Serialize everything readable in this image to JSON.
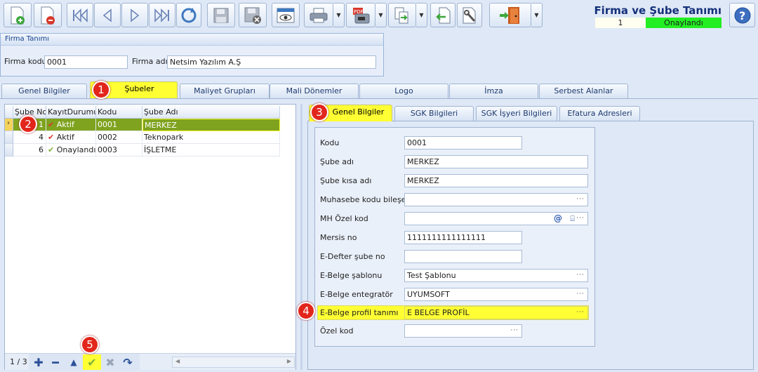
{
  "window": {
    "title": "Firma ve Şube Tanımı",
    "record_no": "1",
    "status": "Onaylandı",
    "status_color": "#22ee22"
  },
  "toolbar": {
    "icons": [
      "new-document-icon",
      "delete-document-icon",
      "first-record-icon",
      "previous-record-icon",
      "next-record-icon",
      "last-record-icon",
      "refresh-icon",
      "save-icon",
      "save-cancel-icon",
      "preview-icon",
      "print-icon",
      "pdf-export-icon",
      "export-icon",
      "back-icon",
      "settings-icon",
      "exit-icon",
      "help-icon"
    ]
  },
  "firma": {
    "group_title": "Firma Tanımı",
    "kod_label": "Firma kodu",
    "kod_value": "0001",
    "adi_label": "Firma adı",
    "adi_value": "Netsim Yazılım A.Ş"
  },
  "main_tabs": [
    {
      "label": "Genel Bilgiler"
    },
    {
      "label": "Şubeler"
    },
    {
      "label": "Maliyet Grupları"
    },
    {
      "label": "Mali Dönemler"
    },
    {
      "label": "Logo"
    },
    {
      "label": "İmza"
    },
    {
      "label": "Serbest Alanlar"
    }
  ],
  "grid": {
    "columns": [
      "Şube No",
      "KayıtDurumu",
      "Kodu",
      "Şube Adı"
    ],
    "rows": [
      {
        "no": "1",
        "durum": "Aktif",
        "kod": "0001",
        "ad": "MERKEZ"
      },
      {
        "no": "4",
        "durum": "Aktif",
        "kod": "0002",
        "ad": "Teknopark"
      },
      {
        "no": "6",
        "durum": "Onaylandı",
        "kod": "0003",
        "ad": "İŞLETME"
      }
    ],
    "pager": "1 / 3"
  },
  "sub_tabs": [
    {
      "label": "Genel Bilgiler"
    },
    {
      "label": "SGK Bilgileri"
    },
    {
      "label": "SGK İşyeri Bilgileri"
    },
    {
      "label": "Efatura Adresleri"
    }
  ],
  "form": {
    "kodu_label": "Kodu",
    "kodu": "0001",
    "sube_adi_label": "Şube adı",
    "sube_adi": "MERKEZ",
    "sube_kisa_label": "Şube kısa adı",
    "sube_kisa": "MERKEZ",
    "muhasebe_label": "Muhasebe kodu bileşeni",
    "muhasebe": "",
    "mh_label": "MH Özel kod",
    "mh": "",
    "mersis_label": "Mersis no",
    "mersis": "1111111111111111",
    "edefter_label": "E-Defter şube no",
    "edefter": "",
    "sablon_label": "E-Belge şablonu",
    "sablon": "Test Şablonu",
    "entegrator_label": "E-Belge entegratör",
    "entegrator": "UYUMSOFT",
    "profil_label": "E-Belge profil tanımı",
    "profil": "E BELGE PROFİL",
    "ozel_label": "Özel kod",
    "ozel": ""
  },
  "ellipsis": "···",
  "callouts": [
    "1",
    "2",
    "3",
    "4",
    "5"
  ],
  "colors": {
    "highlight": "#ffff33",
    "selected_row": "#7fa31f",
    "callout": "#e2261c"
  }
}
